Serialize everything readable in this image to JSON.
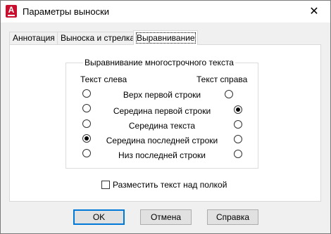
{
  "window": {
    "title": "Параметры выноски",
    "close_glyph": "✕",
    "app_icon_letter": "A",
    "app_icon_color": "#c8102e"
  },
  "tabs": [
    {
      "label": "Аннотация",
      "active": false
    },
    {
      "label": "Выноска и стрелка",
      "active": false
    },
    {
      "label": "Выравнивание",
      "active": true
    }
  ],
  "alignment": {
    "group_title": "Выравнивание многострочного текста",
    "left_header": "Текст слева",
    "right_header": "Текст справа",
    "rows": [
      {
        "label": "Верх первой строки",
        "left_checked": false,
        "right_checked": false
      },
      {
        "label": "Середина первой строки",
        "left_checked": false,
        "right_checked": true
      },
      {
        "label": "Середина текста",
        "left_checked": false,
        "right_checked": false
      },
      {
        "label": "Середина последней строки",
        "left_checked": true,
        "right_checked": false
      },
      {
        "label": "Низ последней строки",
        "left_checked": false,
        "right_checked": false
      }
    ]
  },
  "place_text_above_shelf": {
    "label": "Разместить текст над полкой",
    "checked": false
  },
  "buttons": {
    "ok": "OK",
    "cancel": "Отмена",
    "help": "Справка"
  },
  "colors": {
    "accent": "#0078d7"
  }
}
